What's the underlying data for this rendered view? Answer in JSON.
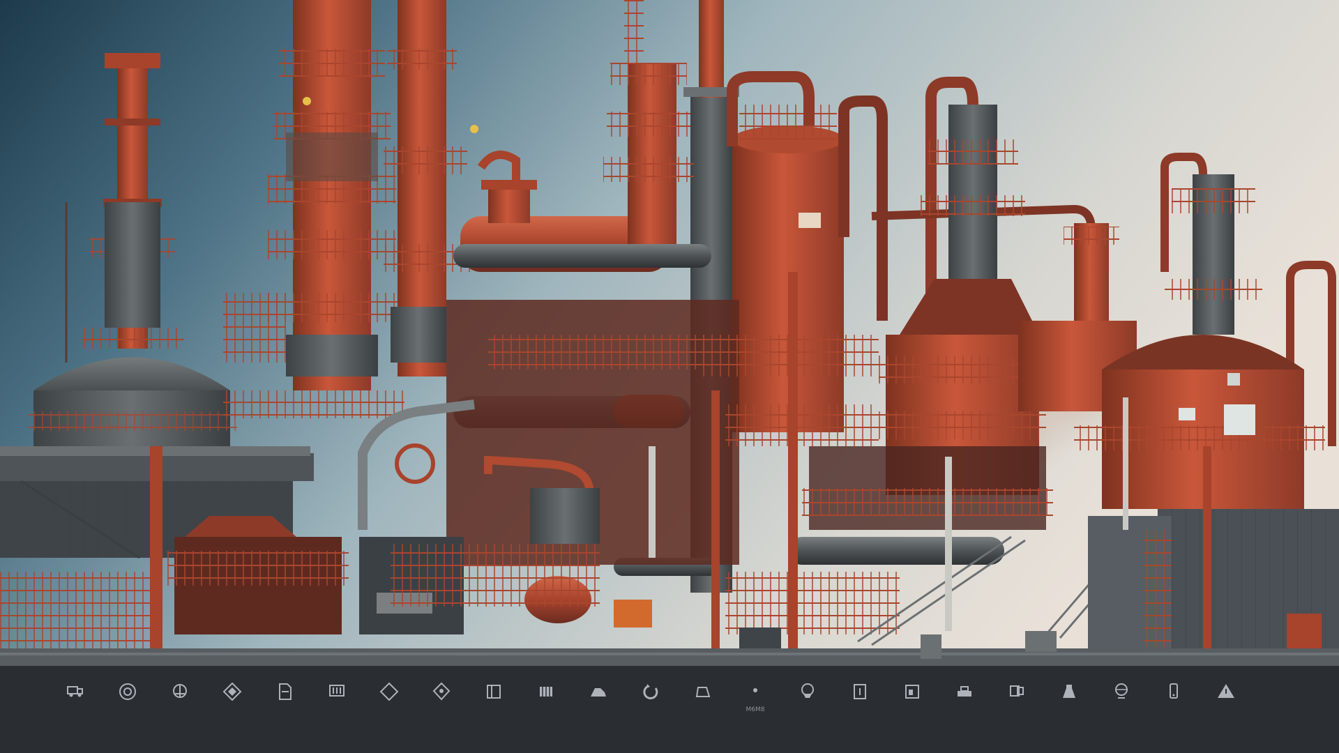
{
  "scene": {
    "sky_colors": [
      "#1c3a4c",
      "#4e7386",
      "#9fb5bd",
      "#d6d6d1",
      "#e9e1d8"
    ],
    "rust_colors": [
      "#b2462e",
      "#c9573a",
      "#8d3a28",
      "#6a2c20"
    ],
    "steel_colors": [
      "#5b6063",
      "#43484c",
      "#2f3336"
    ],
    "ground_color": "#585d62",
    "strip_color": "#2a2d31",
    "tank_sign_text": "",
    "icon_strip": {
      "items": [
        {
          "icon": "truck-icon",
          "caption": ""
        },
        {
          "icon": "gauge-icon",
          "caption": ""
        },
        {
          "icon": "valve-icon",
          "caption": ""
        },
        {
          "icon": "hazard-diamond-icon",
          "caption": ""
        },
        {
          "icon": "document-icon",
          "caption": ""
        },
        {
          "icon": "barcode-icon",
          "caption": ""
        },
        {
          "icon": "diamond-icon",
          "caption": ""
        },
        {
          "icon": "shield-icon",
          "caption": ""
        },
        {
          "icon": "panel-icon",
          "caption": ""
        },
        {
          "icon": "grid-icon",
          "caption": ""
        },
        {
          "icon": "robot-arm-icon",
          "caption": ""
        },
        {
          "icon": "cycle-icon",
          "caption": ""
        },
        {
          "icon": "conveyor-icon",
          "caption": ""
        },
        {
          "icon": "pin-icon",
          "caption": "M6M8"
        },
        {
          "icon": "location-icon",
          "caption": ""
        },
        {
          "icon": "clipboard-icon",
          "caption": ""
        },
        {
          "icon": "chart-panel-icon",
          "caption": ""
        },
        {
          "icon": "printer-icon",
          "caption": ""
        },
        {
          "icon": "monitor-icon",
          "caption": ""
        },
        {
          "icon": "flask-icon",
          "caption": ""
        },
        {
          "icon": "globe-icon",
          "caption": ""
        },
        {
          "icon": "phone-icon",
          "caption": ""
        },
        {
          "icon": "warning-triangle-icon",
          "caption": ""
        }
      ]
    }
  }
}
